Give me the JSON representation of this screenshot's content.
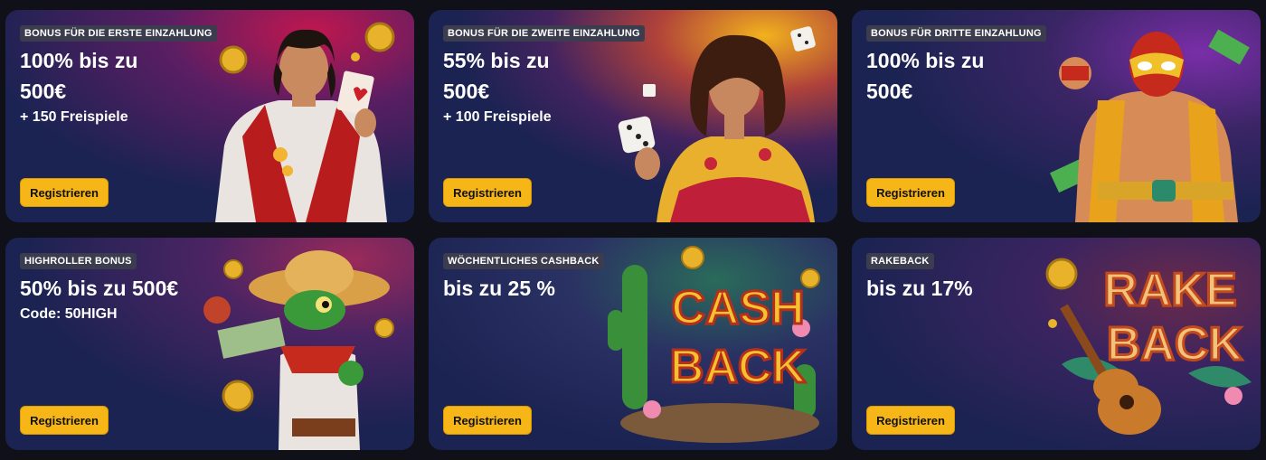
{
  "cards": [
    {
      "badge": "BONUS FÜR DIE ERSTE EINZAHLUNG",
      "headline_1": "100% bis zu",
      "headline_2": "500€",
      "sub": "+ 150 Freispiele",
      "button": "Registrieren",
      "illustration": "gambler-man-with-card"
    },
    {
      "badge": "BONUS FÜR DIE ZWEITE EINZAHLUNG",
      "headline_1": "55% bis zu",
      "headline_2": "500€",
      "sub": "+ 100 Freispiele",
      "button": "Registrieren",
      "illustration": "woman-with-dice"
    },
    {
      "badge": "BONUS FÜR DRITTE EINZAHLUNG",
      "headline_1": "100% bis zu",
      "headline_2": "500€",
      "sub": "",
      "button": "Registrieren",
      "illustration": "luchador-wrestler"
    },
    {
      "badge": "HIGHROLLER BONUS",
      "headline_1": "50% bis zu 500€",
      "headline_2": "",
      "sub": "Code: 50HIGH",
      "button": "Registrieren",
      "illustration": "lizard-with-sombrero"
    },
    {
      "badge": "WÖCHENTLICHES CASHBACK",
      "headline_1": "bis zu 25 %",
      "headline_2": "",
      "sub": "",
      "button": "Registrieren",
      "illustration": "cashback-cactus",
      "art_text_1": "CASH",
      "art_text_2": "BACK"
    },
    {
      "badge": "RAKEBACK",
      "headline_1": "bis zu 17%",
      "headline_2": "",
      "sub": "",
      "button": "Registrieren",
      "illustration": "rakeback-guitar",
      "art_text_1": "RAKE",
      "art_text_2": "BACK"
    }
  ],
  "colors": {
    "button": "#f7b618",
    "badge": "#3b3d4e",
    "page": "#101018",
    "card_dark": "#1c2452"
  }
}
